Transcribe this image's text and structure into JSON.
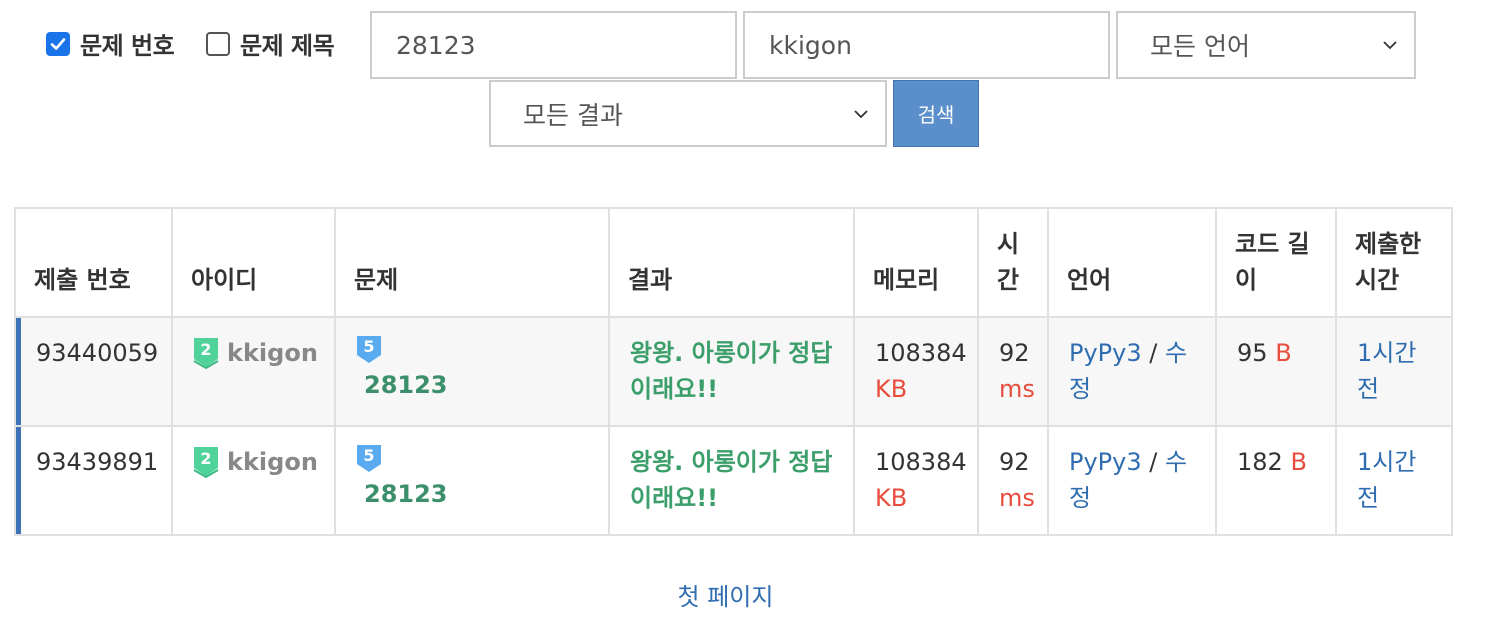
{
  "filters": {
    "problem_number": {
      "label": "문제 번호",
      "checked": true
    },
    "problem_title": {
      "label": "문제 제목",
      "checked": false
    },
    "problem_input": "28123",
    "user_input": "kkigon",
    "language_select": "모든 언어",
    "result_select": "모든 결과",
    "search_label": "검색"
  },
  "table": {
    "headers": [
      "제출 번호",
      "아이디",
      "문제",
      "결과",
      "메모리",
      "시간",
      "언어",
      "코드 길이",
      "제출한 시간"
    ],
    "rows": [
      {
        "submission_id": "93440059",
        "user_tier": "2",
        "user": "kkigon",
        "problem_tier": "5",
        "problem": "28123",
        "result": "왕왕. 아롱이가 정답이래요!!",
        "memory": "108384",
        "memory_unit": "KB",
        "time": "92",
        "time_unit": "ms",
        "language": "PyPy3",
        "language_sep": "/",
        "edit": "수정",
        "code_length": "95",
        "code_unit": "B",
        "submitted": "1시간 전"
      },
      {
        "submission_id": "93439891",
        "user_tier": "2",
        "user": "kkigon",
        "problem_tier": "5",
        "problem": "28123",
        "result": "왕왕. 아롱이가 정답이래요!!",
        "memory": "108384",
        "memory_unit": "KB",
        "time": "92",
        "time_unit": "ms",
        "language": "PyPy3",
        "language_sep": "/",
        "edit": "수정",
        "code_length": "182",
        "code_unit": "B",
        "submitted": "1시간 전"
      }
    ]
  },
  "pagination": {
    "first_page": "첫 페이지"
  },
  "colors": {
    "accent_blue": "#2f6db0",
    "button_blue": "#5b8fcc",
    "success_green": "#3c9f6b",
    "unit_red": "#e74c3c",
    "user_tier_green": "#4fd39a",
    "problem_tier_blue": "#5aaaf0"
  },
  "icons": {
    "check": "checkbox-check-icon",
    "chevron": "chevron-down-icon",
    "user_tier": "silver-tier-badge-icon",
    "problem_tier": "bronze-tier-badge-icon"
  }
}
